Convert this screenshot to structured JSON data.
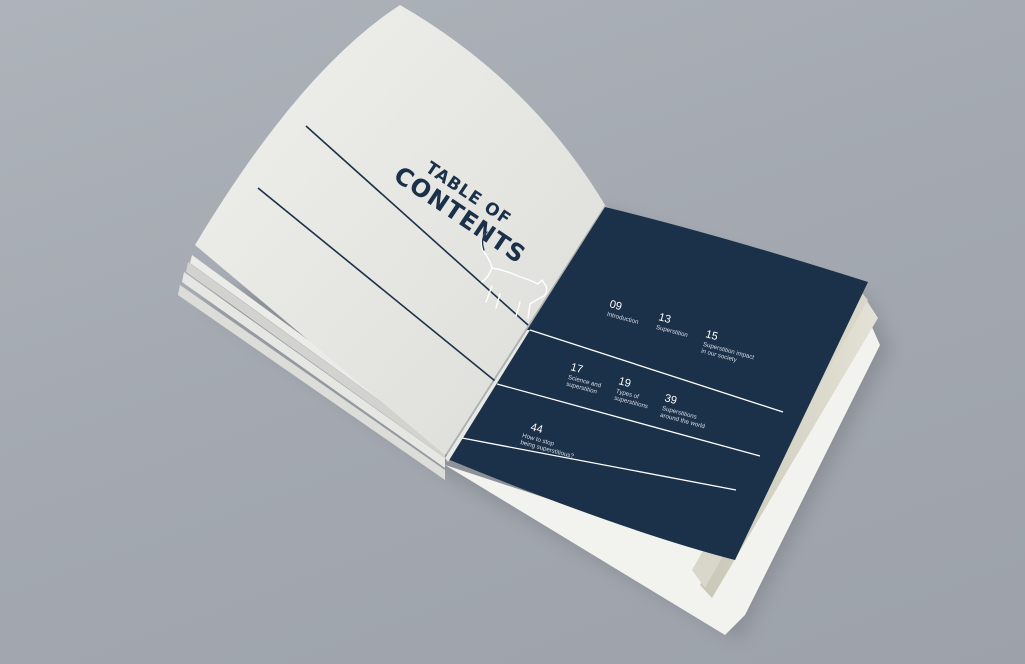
{
  "booklet": {
    "title_line1": "TABLE OF",
    "title_line2": "CONTENTS",
    "colors": {
      "background": "#a4a9b1",
      "left_page": "#e8e8e5",
      "right_page_panel": "#1b3049",
      "page_edges": "#d6d4c8",
      "accent_line": "#1b3049"
    },
    "illustration": "cat-outline-icon",
    "entries": [
      {
        "page": "09",
        "label_lines": [
          "Introduction"
        ]
      },
      {
        "page": "13",
        "label_lines": [
          "Superstition"
        ]
      },
      {
        "page": "15",
        "label_lines": [
          "Superstition impact",
          "in our society"
        ]
      },
      {
        "page": "17",
        "label_lines": [
          "Science and",
          "superstition"
        ]
      },
      {
        "page": "19",
        "label_lines": [
          "Types of",
          "superstitions"
        ]
      },
      {
        "page": "39",
        "label_lines": [
          "Superstitions",
          "around the world"
        ]
      },
      {
        "page": "44",
        "label_lines": [
          "How to stop",
          "being superstitious?"
        ]
      }
    ]
  }
}
